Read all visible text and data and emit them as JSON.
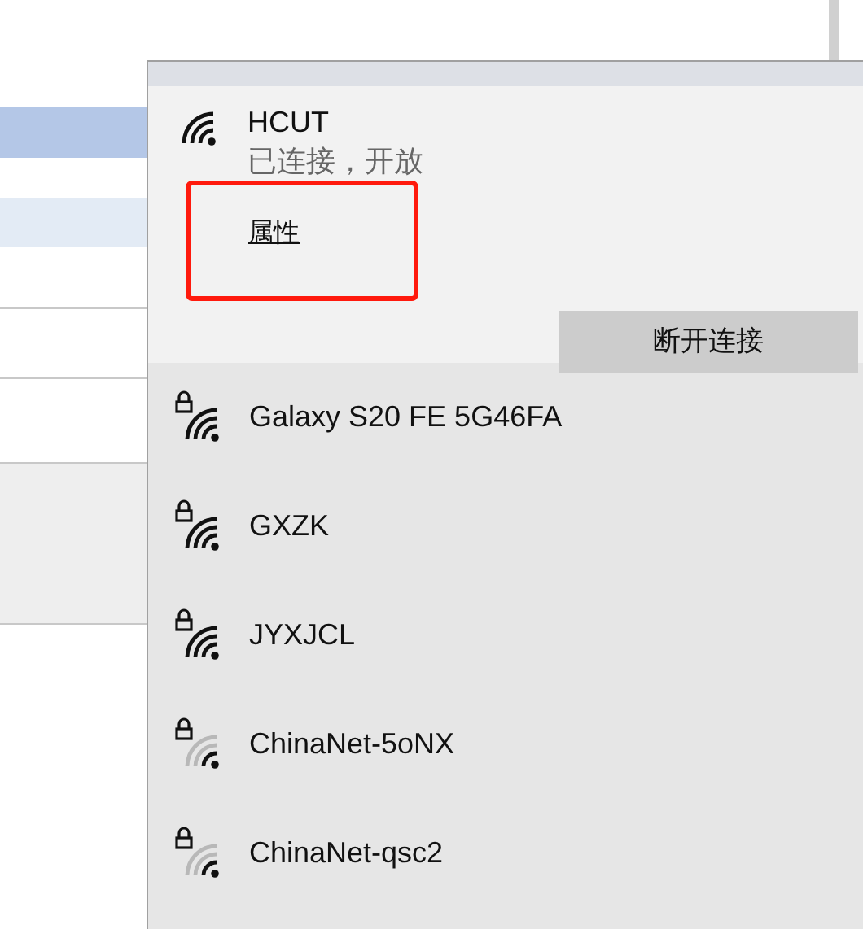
{
  "connected": {
    "name": "HCUT",
    "status": "已连接，开放",
    "properties": {
      "label": "属性",
      "highlighted": true
    },
    "disconnect_button": "断开连接"
  },
  "networks": [
    {
      "name": "Galaxy S20 FE 5G46FA",
      "secured": true,
      "kind": "strong"
    },
    {
      "name": "GXZK",
      "secured": true,
      "kind": "strong"
    },
    {
      "name": "JYXJCL",
      "secured": true,
      "kind": "strong"
    },
    {
      "name": "ChinaNet-5oNX",
      "secured": true,
      "kind": "weak"
    },
    {
      "name": "ChinaNet-qsc2",
      "secured": true,
      "kind": "weak"
    }
  ]
}
